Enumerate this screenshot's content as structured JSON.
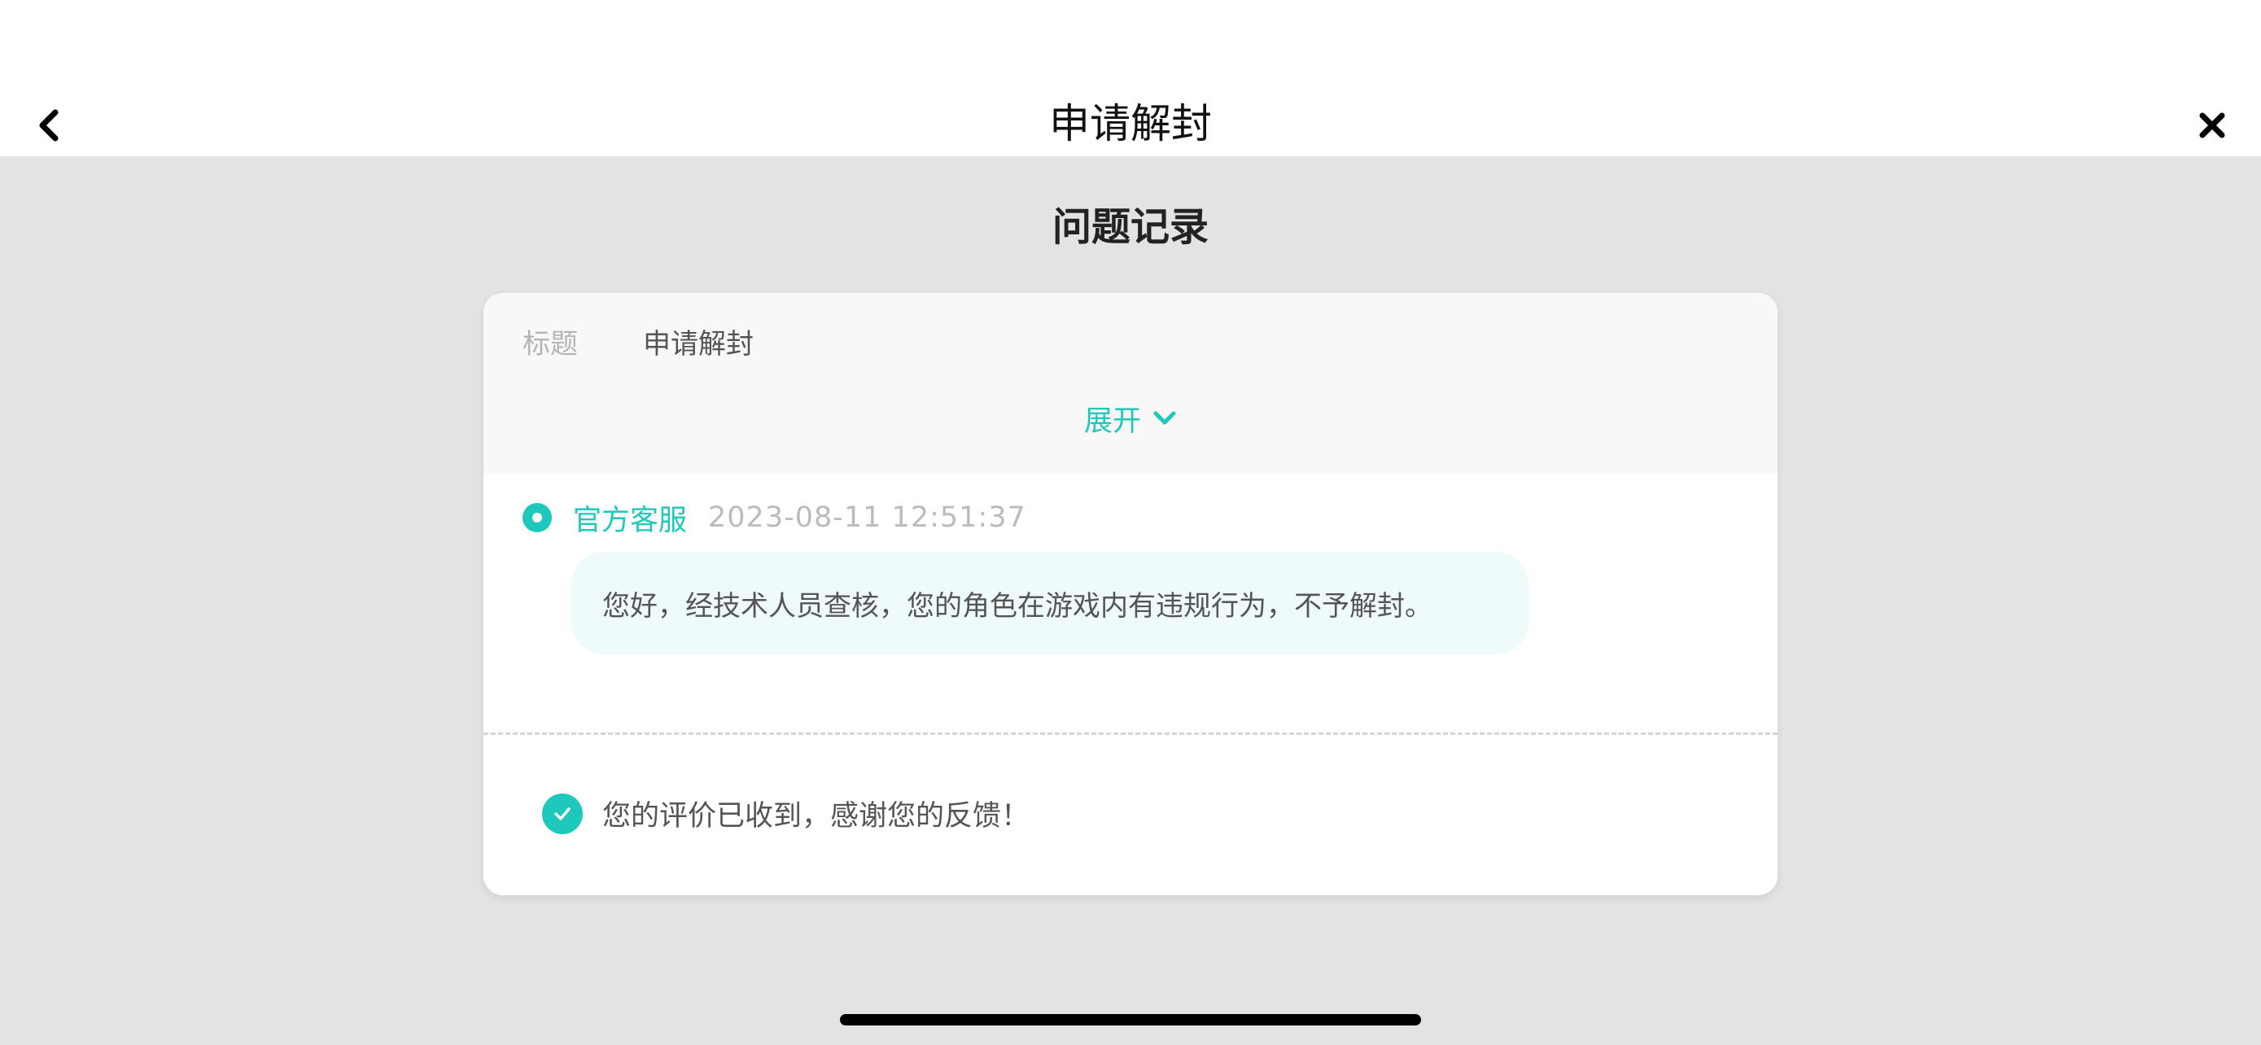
{
  "nav": {
    "title": "申请解封",
    "back_icon": "chevron-left-icon",
    "close_icon": "close-icon"
  },
  "section_title": "问题记录",
  "ticket": {
    "title_label": "标题",
    "title_value": "申请解封",
    "expand_label": "展开",
    "expand_icon": "chevron-down-icon"
  },
  "message": {
    "sender": "官方客服",
    "timestamp": "2023-08-11 12:51:37",
    "text": "您好，经技术人员查核，您的角色在游戏内有违规行为，不予解封。"
  },
  "feedback": {
    "text": "您的评价已收到，感谢您的反馈！",
    "icon": "check-circle-icon"
  },
  "colors": {
    "accent": "#1ec9bb",
    "page_background": "#e3e3e3",
    "bubble_background": "#effafa"
  }
}
